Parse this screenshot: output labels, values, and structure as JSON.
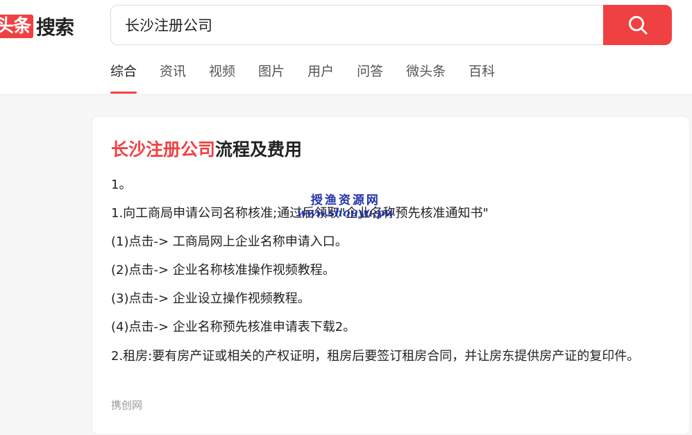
{
  "logo": {
    "box_text": "头条",
    "text": "搜索"
  },
  "search": {
    "value": "长沙注册公司",
    "button_icon": "search-icon"
  },
  "tabs": [
    {
      "label": "综合",
      "active": true
    },
    {
      "label": "资讯"
    },
    {
      "label": "视频"
    },
    {
      "label": "图片"
    },
    {
      "label": "用户"
    },
    {
      "label": "问答"
    },
    {
      "label": "微头条"
    },
    {
      "label": "百科"
    }
  ],
  "result": {
    "title_highlight": "长沙注册公司",
    "title_rest": "流程及费用",
    "lines": [
      "1。",
      "1.向工商局申请公司名称核准;通过后领取\"企业名称预先核准通知书\"",
      "(1)点击-> 工商局网上企业名称申请入口。",
      "(2)点击-> 企业名称核准操作视频教程。",
      "(3)点击-> 企业设立操作视频教程。",
      "(4)点击-> 企业名称预先核准申请表下载2。",
      "2.租房:要有房产证或相关的产权证明，租房后要签订租房合同，并让房东提供房产证的复印件。"
    ],
    "source": "携创网"
  },
  "watermark": {
    "line1": "授渔资源网",
    "line2": "www.shouyu.pw"
  },
  "colors": {
    "accent": "#f04142",
    "watermark": "#2233aa"
  }
}
